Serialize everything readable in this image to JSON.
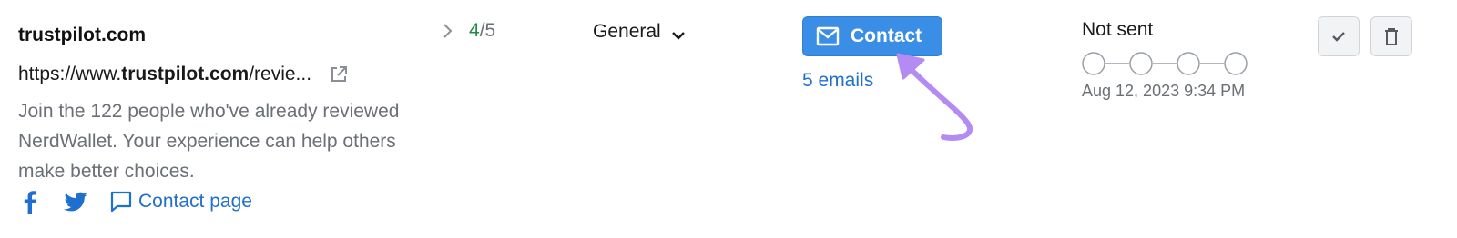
{
  "row": {
    "domain": "trustpilot.com",
    "url_prefix": "https://www.",
    "url_bold": "trustpilot.com",
    "url_suffix": "/revie...",
    "description": "Join the 122 people who've already reviewed NerdWallet. Your experience can help others make better choices.",
    "contact_page_label": "Contact page",
    "score_value": "4",
    "score_total": "/5",
    "category": "General",
    "contact_button_label": "Contact",
    "emails_link": "5 emails",
    "status": "Not sent",
    "timestamp": "Aug 12, 2023 9:34 PM"
  },
  "icons": {
    "external": "external-link-icon",
    "facebook": "facebook-icon",
    "twitter": "twitter-icon",
    "chat": "chat-icon",
    "expand": "chevron-right-icon",
    "dropdown": "chevron-down-icon",
    "mail": "mail-icon",
    "confirm": "check-icon",
    "delete": "trash-icon"
  },
  "colors": {
    "accent_blue": "#3a8ee6",
    "link_blue": "#1f6fce",
    "score_green": "#1f8a44",
    "annotation_arrow": "#b38bf2"
  }
}
